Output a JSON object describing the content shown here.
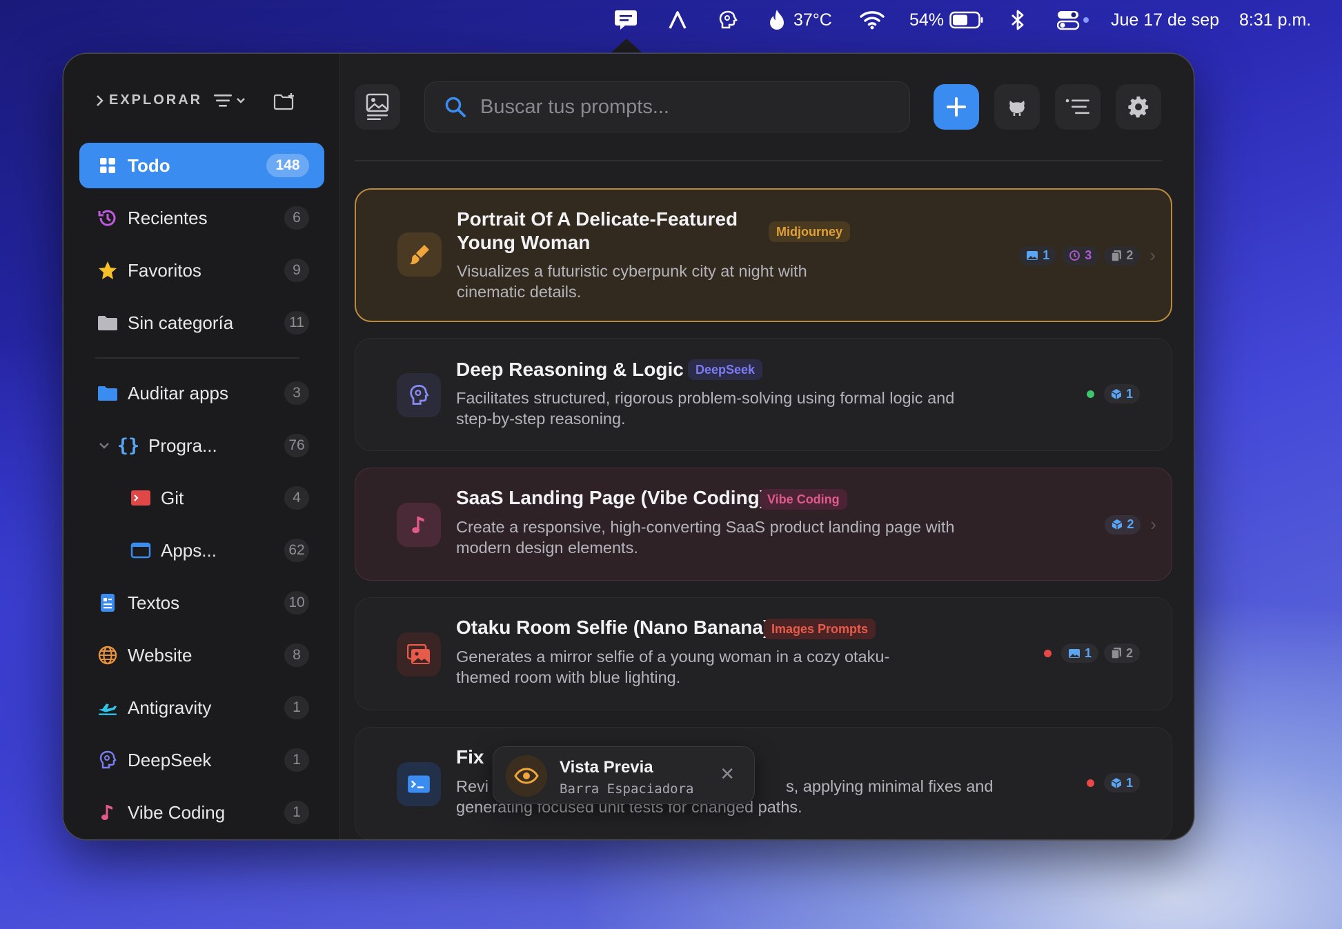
{
  "menubar": {
    "temperature": "37°C",
    "battery": "54%",
    "date": "Jue 17 de sep",
    "time": "8:31 p.m."
  },
  "sidebar": {
    "title": "EXPLORAR",
    "items": [
      {
        "label": "Todo",
        "count": "148"
      },
      {
        "label": "Recientes",
        "count": "6"
      },
      {
        "label": "Favoritos",
        "count": "9"
      },
      {
        "label": "Sin categoría",
        "count": "11"
      },
      {
        "label": "Auditar apps",
        "count": "3"
      },
      {
        "label": "Progra...",
        "count": "76"
      },
      {
        "label": "Git",
        "count": "4"
      },
      {
        "label": "Apps...",
        "count": "62"
      },
      {
        "label": "Textos",
        "count": "10"
      },
      {
        "label": "Website",
        "count": "8"
      },
      {
        "label": "Antigravity",
        "count": "1"
      },
      {
        "label": "DeepSeek",
        "count": "1"
      },
      {
        "label": "Vibe Coding",
        "count": "1"
      }
    ]
  },
  "search": {
    "placeholder": "Buscar tus prompts..."
  },
  "cards": [
    {
      "title_line1": "Portrait Of A Delicate-Featured",
      "title_line2": "Young Woman",
      "tag": "Midjourney",
      "desc_line1": "Visualizes a futuristic cyberpunk city at night with",
      "desc_line2": "cinematic details.",
      "pills": [
        "1",
        "3",
        "2"
      ]
    },
    {
      "title": "Deep Reasoning & Logic",
      "tag": "DeepSeek",
      "desc_line1": "Facilitates structured, rigorous problem-solving using formal logic and",
      "desc_line2": "step-by-step reasoning.",
      "pills": [
        "1"
      ]
    },
    {
      "title": "SaaS Landing Page (Vibe Coding)",
      "tag": "Vibe Coding",
      "desc_line1": "Create a responsive, high-converting SaaS product landing page with",
      "desc_line2": "modern design elements.",
      "pills": [
        "2"
      ]
    },
    {
      "title": "Otaku Room Selfie (Nano Banana)",
      "tag": "Images Prompts",
      "desc_line1": "Generates a mirror selfie of a young woman in a cozy otaku-",
      "desc_line2": "themed room with blue lighting.",
      "pills": [
        "1",
        "2"
      ]
    },
    {
      "title": "Fix",
      "desc_prefix": "Revi",
      "desc_line1_end": "s, applying minimal fixes and",
      "desc_line2": "generating focused unit tests for changed paths.",
      "pills": [
        "1"
      ]
    }
  ],
  "toast": {
    "title": "Vista Previa",
    "subtitle": "Barra Espaciadora"
  },
  "colors": {
    "accent": "#3a8cf0",
    "midjourney": "#e0a03a",
    "deepseek": "#7b7cf0",
    "vibe": "#e05a8a",
    "images": "#e85a4a"
  }
}
